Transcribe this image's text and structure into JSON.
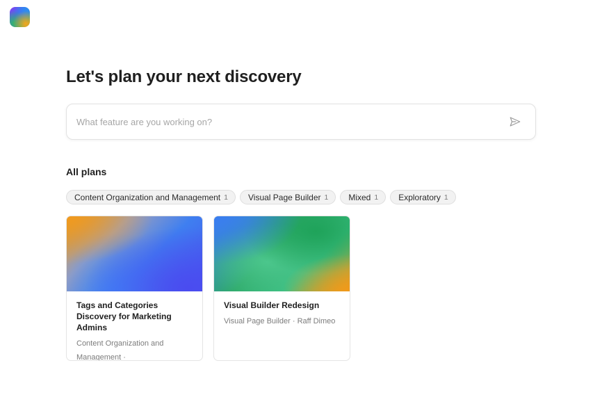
{
  "header": {
    "logo_icon": "app-logo-gradient"
  },
  "main": {
    "title": "Let's plan your next discovery",
    "search": {
      "placeholder": "What feature are you working on?",
      "value": "",
      "send_icon": "send-icon"
    },
    "section_title": "All plans",
    "filters": [
      {
        "label": "Content Organization and Management",
        "count": "1"
      },
      {
        "label": "Visual Page Builder",
        "count": "1"
      },
      {
        "label": "Mixed",
        "count": "1"
      },
      {
        "label": "Exploratory",
        "count": "1"
      }
    ],
    "plans": [
      {
        "title": "Tags and Categories Discovery for Marketing Admins",
        "meta": "Content Organization and Management ·"
      },
      {
        "title": "Visual Builder Redesign",
        "meta": "Visual Page Builder · Raff Dimeo"
      }
    ]
  },
  "colors": {
    "text": "#1f1f1f",
    "muted": "#7c7c7c",
    "chip_bg": "#f2f2f2",
    "border": "#e4e4e4"
  }
}
